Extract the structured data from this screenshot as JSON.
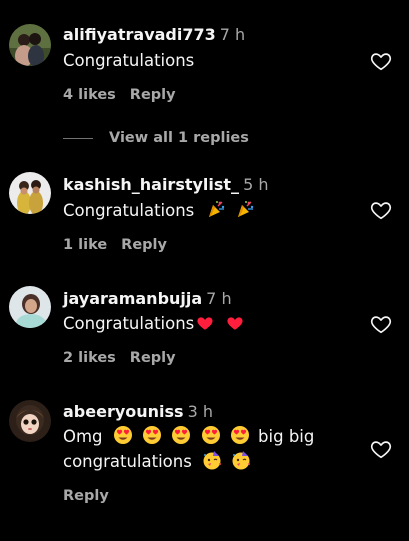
{
  "comments": [
    {
      "username": "alifiyatravadi773",
      "time": "7 h",
      "text": "Congratulations",
      "likes": "4 likes",
      "reply_label": "Reply",
      "avatar_colors": [
        "#6d7f4a",
        "#3e4c2a",
        "#c59b8a"
      ]
    },
    {
      "username": "kashish_hairstylist_",
      "time": "5 h",
      "text": "Congratulations",
      "emoji_icons": [
        "party-popper-icon",
        "party-popper-icon"
      ],
      "likes": "1 like",
      "reply_label": "Reply",
      "avatar_colors": [
        "#e9e9e9",
        "#d7b43a",
        "#6b4a2e"
      ]
    },
    {
      "username": "jayaramanbujja",
      "time": "7 h",
      "text": "Congratulations",
      "emoji_icons": [
        "red-heart-icon",
        "red-heart-icon"
      ],
      "likes": "2 likes",
      "reply_label": "Reply",
      "avatar_colors": [
        "#dfe6ea",
        "#a7d9d5",
        "#5a3b2f"
      ]
    },
    {
      "username": "abeeryouniss",
      "time": "3 h",
      "text_line1_start": "Omg",
      "text_line1_end": "big big",
      "text_line2": "congratulations",
      "emoji_icons_line1": [
        "heart-eyes-emoji-icon",
        "heart-eyes-emoji-icon",
        "heart-eyes-emoji-icon",
        "heart-eyes-emoji-icon",
        "heart-eyes-emoji-icon"
      ],
      "emoji_icons_line2": [
        "partying-face-icon",
        "partying-face-icon"
      ],
      "reply_label": "Reply",
      "avatar_colors": [
        "#3a2a1f",
        "#8b5a3c",
        "#f2d4c2"
      ]
    }
  ],
  "view_replies_label": "View all 1 replies",
  "colors": {
    "background": "#000000",
    "primary_text": "#f5f5f5",
    "secondary_text": "#a8a8a8",
    "heart_red": "#ff1e3c"
  }
}
